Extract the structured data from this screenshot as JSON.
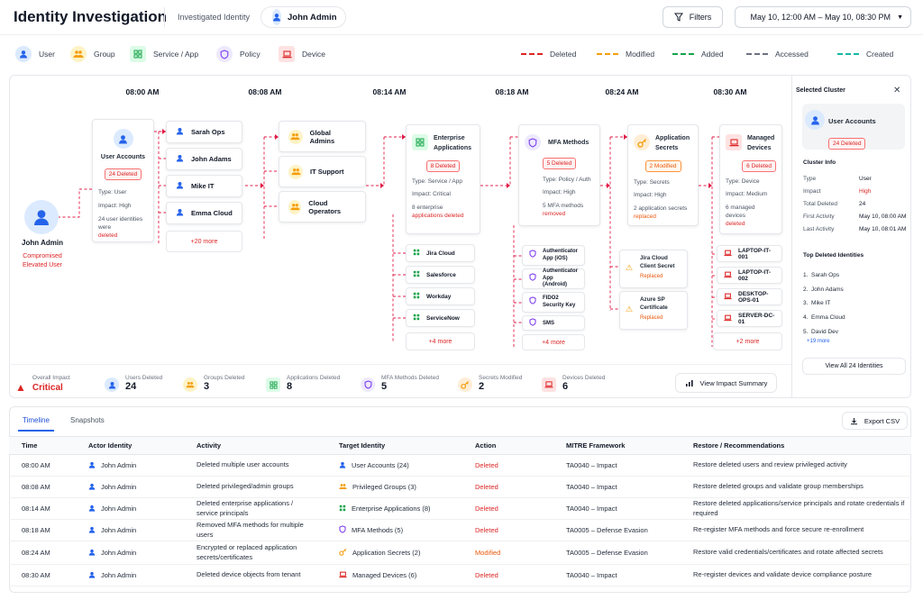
{
  "header": {
    "title": "Identity Investigation",
    "investigated_label": "Investigated Identity",
    "identity_name": "John Admin",
    "filters_label": "Filters",
    "date_range": "May 10, 12:00 AM – May 10, 08:30 PM"
  },
  "legend": {
    "types": [
      {
        "label": "User",
        "icon": "user-icon",
        "color": "#2563eb"
      },
      {
        "label": "Group",
        "icon": "group-icon",
        "color": "#f59e0b"
      },
      {
        "label": "Service / App",
        "icon": "app-grid-icon",
        "color": "#16a34a"
      },
      {
        "label": "Policy",
        "icon": "shield-icon",
        "color": "#7c3aed"
      },
      {
        "label": "Device",
        "icon": "laptop-icon",
        "color": "#dc2626"
      }
    ],
    "lines": [
      {
        "label": "Deleted",
        "color": "#dc2626"
      },
      {
        "label": "Modified",
        "color": "#f59e0b"
      },
      {
        "label": "Added",
        "color": "#16a34a"
      },
      {
        "label": "Accessed",
        "color": "#6b7280"
      },
      {
        "label": "Created",
        "color": "#14b8a6"
      }
    ]
  },
  "times": [
    "08:00 AM",
    "08:08 AM",
    "08:14 AM",
    "08:18 AM",
    "08:24 AM",
    "08:30 AM"
  ],
  "root": {
    "name": "John Admin",
    "status": "Compromised Elevated User"
  },
  "clusters": {
    "user_accounts": {
      "title": "User Accounts",
      "badge": "24 Deleted",
      "type": "Type: User",
      "impact": "Impact: High",
      "desc": "24 user identities were",
      "desc2": "deleted"
    },
    "users": [
      "Sarah Ops",
      "John Adams",
      "Mike IT",
      "Emma Cloud"
    ],
    "users_more": "+20 more",
    "groups": [
      "Global Admins",
      "IT Support",
      "Cloud Operators"
    ],
    "apps": {
      "title": "Enterprise Applications",
      "badge": "8 Deleted",
      "type": "Type: Service / App",
      "impact": "Impact: Critical",
      "desc": "8 enterprise",
      "desc2": "applications deleted",
      "items": [
        "Jira Cloud",
        "Salesforce",
        "Workday",
        "ServiceNow"
      ],
      "more": "+4 more"
    },
    "mfa": {
      "title": "MFA Methods",
      "badge": "5 Deleted",
      "type": "Type: Policy / Auth",
      "impact": "Impact: High",
      "desc": "5 MFA methods",
      "desc2": "removed",
      "items": [
        "Authenticator App (iOS)",
        "Authenticator App (Android)",
        "FIDO2 Security Key",
        "SMS"
      ],
      "more": "+4 more"
    },
    "secrets": {
      "title": "Application Secrets",
      "badge": "2 Modified",
      "type": "Type: Secrets",
      "impact": "Impact: High",
      "desc": "2 application secrets",
      "desc2": "replaced",
      "items": [
        {
          "name": "Jira Cloud Client Secret",
          "status": "Replaced"
        },
        {
          "name": "Azure SP Certificate",
          "status": "Replaced"
        }
      ]
    },
    "devices": {
      "title": "Managed Devices",
      "badge": "6 Deleted",
      "type": "Type: Device",
      "impact": "Impact: Medium",
      "desc": "6 managed devices",
      "desc2": "deleted",
      "items": [
        "LAPTOP-IT-001",
        "LAPTOP-IT-002",
        "DESKTOP-OPS-01",
        "SERVER-DC-01"
      ],
      "more": "+2 more"
    }
  },
  "impact": {
    "overall_label": "Overall Impact",
    "overall_value": "Critical",
    "items": [
      {
        "label": "Users Deleted",
        "value": "24"
      },
      {
        "label": "Groups Deleted",
        "value": "3"
      },
      {
        "label": "Applications Deleted",
        "value": "8"
      },
      {
        "label": "MFA Methods Deleted",
        "value": "5"
      },
      {
        "label": "Secrets Modified",
        "value": "2"
      },
      {
        "label": "Devices Deleted",
        "value": "6"
      }
    ],
    "summary_btn": "View Impact Summary"
  },
  "side_panel": {
    "title": "Selected Cluster",
    "cluster_name": "User Accounts",
    "badge": "24 Deleted",
    "info_title": "Cluster Info",
    "info": [
      {
        "k": "Type",
        "v": "User"
      },
      {
        "k": "Impact",
        "v": "High"
      },
      {
        "k": "Total Deleted",
        "v": "24"
      },
      {
        "k": "First Activity",
        "v": "May 10, 08:00 AM"
      },
      {
        "k": "Last Activity",
        "v": "May 10, 08:01 AM"
      }
    ],
    "top_title": "Top Deleted Identities",
    "top": [
      "1.  Sarah Ops",
      "2.  John Adams",
      "3.  Mike IT",
      "4.  Emma Cloud",
      "5.  David Dev"
    ],
    "more": "+19 more",
    "view_all": "View All 24 Identities"
  },
  "tabs": {
    "timeline": "Timeline",
    "snapshots": "Snapshots",
    "export": "Export CSV"
  },
  "table": {
    "headers": [
      "Time",
      "Actor Identity",
      "Activity",
      "Target Identity",
      "Action",
      "MITRE Framework",
      "Restore / Recommendations"
    ],
    "rows": [
      {
        "time": "08:00 AM",
        "actor": "John Admin",
        "activity": "Deleted multiple user accounts",
        "target": "User Accounts (24)",
        "action": "Deleted",
        "mitre": "TA0040 – Impact",
        "rec": "Restore deleted users and review privileged activity"
      },
      {
        "time": "08:08 AM",
        "actor": "John Admin",
        "activity": "Deleted privileged/admin groups",
        "target": "Privileged Groups (3)",
        "action": "Deleted",
        "mitre": "TA0040 – Impact",
        "rec": "Restore deleted groups and validate group memberships"
      },
      {
        "time": "08:14 AM",
        "actor": "John Admin",
        "activity": "Deleted enterprise applications / service principals",
        "target": "Enterprise Applications (8)",
        "action": "Deleted",
        "mitre": "TA0040 – Impact",
        "rec": "Restore deleted applications/service principals and rotate credentials if required"
      },
      {
        "time": "08:18 AM",
        "actor": "John Admin",
        "activity": "Removed MFA methods for multiple users",
        "target": "MFA Methods (5)",
        "action": "Deleted",
        "mitre": "TA0005 – Defense Evasion",
        "rec": "Re-register MFA methods and force secure re-enrollment"
      },
      {
        "time": "08:24 AM",
        "actor": "John Admin",
        "activity": "Encrypted or replaced application secrets/certificates",
        "target": "Application Secrets (2)",
        "action": "Modified",
        "mitre": "TA0005 – Defense Evasion",
        "rec": "Restore valid credentials/certificates and rotate affected secrets"
      },
      {
        "time": "08:30 AM",
        "actor": "John Admin",
        "activity": "Deleted device objects from tenant",
        "target": "Managed Devices (6)",
        "action": "Deleted",
        "mitre": "TA0040 – Impact",
        "rec": "Re-register devices and validate device compliance posture"
      }
    ]
  }
}
